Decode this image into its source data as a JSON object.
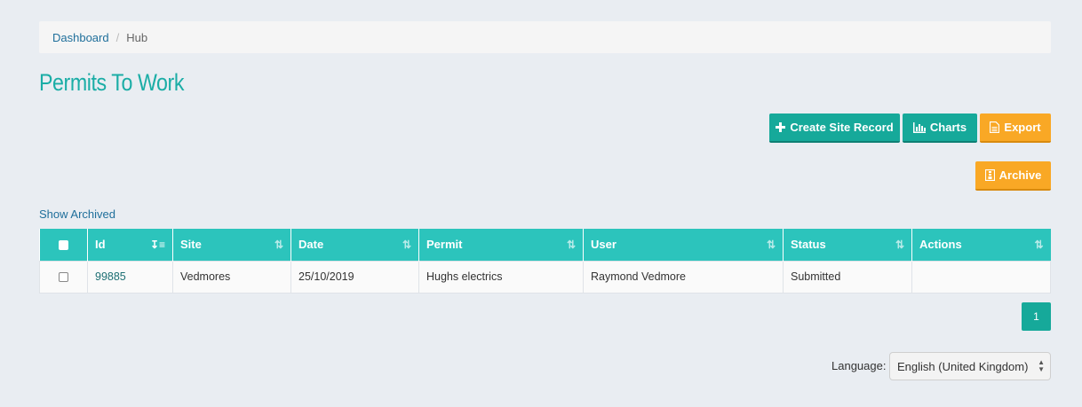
{
  "breadcrumb": {
    "dashboard": "Dashboard",
    "separator": "/",
    "current": "Hub"
  },
  "page": {
    "title": "Permits To Work"
  },
  "toolbar": {
    "create_label": "Create Site Record",
    "charts_label": "Charts",
    "export_label": "Export",
    "archive_label": "Archive"
  },
  "links": {
    "show_archived": "Show Archived"
  },
  "table": {
    "headers": [
      "Id",
      "Site",
      "Date",
      "Permit",
      "User",
      "Status",
      "Actions"
    ],
    "rows": [
      {
        "id": "99885",
        "site": "Vedmores",
        "date": "25/10/2019",
        "permit": "Hughs electrics",
        "user": "Raymond Vedmore",
        "status": "Submitted",
        "actions": ""
      }
    ]
  },
  "pagination": {
    "current_page": "1"
  },
  "language": {
    "label": "Language:",
    "selected": "English (United Kingdom)"
  },
  "colors": {
    "accent": "#16a99a",
    "header": "#2cc4bc",
    "warning": "#f9a825",
    "title": "#1bada6",
    "link": "#1f6f9b"
  },
  "icons": {
    "create": "plus-icon",
    "charts": "bar-chart-icon",
    "export": "file-icon",
    "archive": "archive-icon",
    "sort": "sort-icon"
  }
}
